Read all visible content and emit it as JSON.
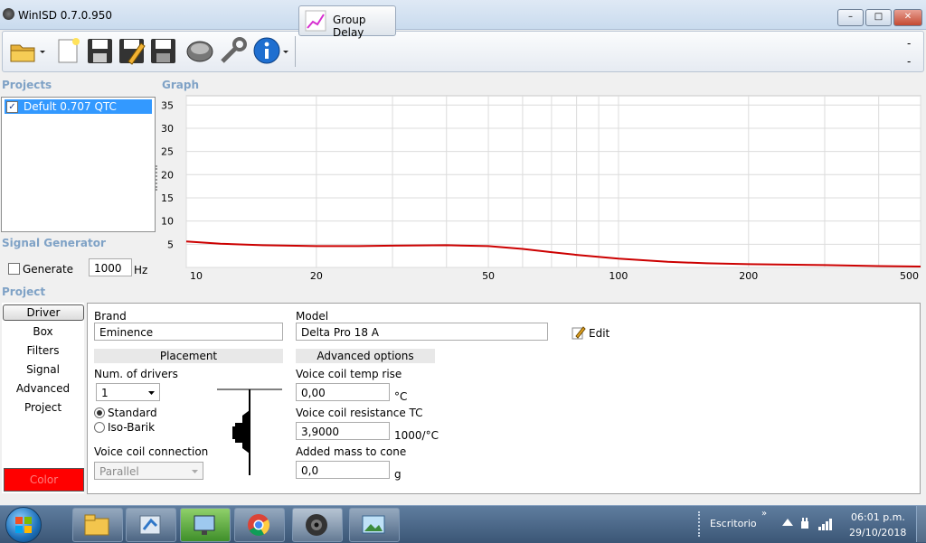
{
  "window": {
    "title": "WinISD 0.7.0.950",
    "minimize": "–",
    "maximize": "□",
    "close": "✕"
  },
  "toolbar": {
    "group_delay_label": "Group Delay",
    "right_marks": [
      "-",
      "-"
    ]
  },
  "projects": {
    "label": "Projects",
    "items": [
      {
        "name": "Defult 0.707 QTC",
        "checked": true
      }
    ]
  },
  "graph": {
    "label": "Graph",
    "y_ticks": [
      "35",
      "30",
      "25",
      "20",
      "15",
      "10",
      "5"
    ],
    "x_ticks": [
      "10",
      "20",
      "50",
      "100",
      "200",
      "500"
    ],
    "line_color": "#cc0000"
  },
  "chart_data": {
    "type": "line",
    "x_scale": "log",
    "ylim": [
      0,
      37
    ],
    "xlim": [
      10,
      500
    ],
    "x_tick_labels": [
      "10",
      "20",
      "50",
      "100",
      "200",
      "500"
    ],
    "y_tick_labels": [
      "5",
      "10",
      "15",
      "20",
      "25",
      "30",
      "35"
    ],
    "series": [
      {
        "x": [
          10,
          12,
          15,
          20,
          25,
          30,
          40,
          50,
          60,
          70,
          80,
          100,
          130,
          160,
          200,
          300,
          400,
          500
        ],
        "values": [
          5.6,
          5.1,
          4.8,
          4.6,
          4.6,
          4.7,
          4.8,
          4.6,
          4.0,
          3.3,
          2.7,
          1.9,
          1.2,
          0.9,
          0.7,
          0.5,
          0.3,
          0.2
        ]
      }
    ]
  },
  "signal_generator": {
    "label": "Signal Generator",
    "generate_label": "Generate",
    "frequency": "1000",
    "unit": "Hz"
  },
  "project": {
    "label": "Project",
    "nav": [
      "Driver",
      "Box",
      "Filters",
      "Signal",
      "Advanced",
      "Project"
    ],
    "color_label": "Color",
    "color_value": "#ff0000"
  },
  "driver": {
    "brand_label": "Brand",
    "brand": "Eminence",
    "model_label": "Model",
    "model": "Delta Pro 18 A",
    "edit_label": "Edit",
    "placement_header": "Placement",
    "num_drivers_label": "Num. of drivers",
    "num_drivers": "1",
    "standard_label": "Standard",
    "isobarik_label": "Iso-Barik",
    "voice_coil_connection_label": "Voice coil connection",
    "voice_coil_connection": "Parallel",
    "advanced_header": "Advanced options",
    "temp_rise_label": "Voice coil temp rise",
    "temp_rise": "0,00",
    "temp_rise_unit": "°C",
    "resistance_tc_label": "Voice coil resistance TC",
    "resistance_tc": "3,9000",
    "resistance_tc_unit": "1000/°C",
    "added_mass_label": "Added mass to cone",
    "added_mass": "0,0",
    "added_mass_unit": "g"
  },
  "taskbar": {
    "tray_label": "Escritorio",
    "time": "06:01 p.m.",
    "date": "29/10/2018"
  }
}
